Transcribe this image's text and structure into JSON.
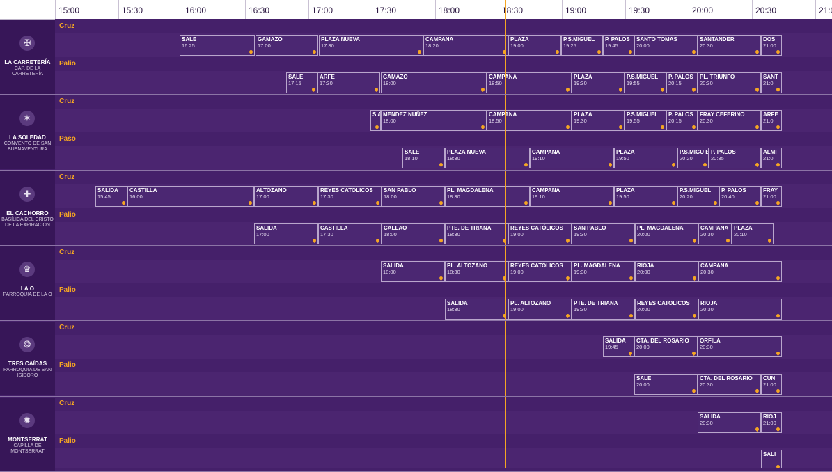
{
  "timeline": {
    "hours": [
      "15:00",
      "15:30",
      "16:00",
      "16:30",
      "17:00",
      "17:30",
      "18:00",
      "18:30",
      "19:00",
      "19:30",
      "20:00",
      "20:30",
      "21:0"
    ],
    "now_marker": "18:30"
  },
  "colors": {
    "accent": "#f5a623",
    "background": "#45206a",
    "sidebar": "#371658"
  },
  "brotherhoods": [
    {
      "name": "LA CARRETERÍA",
      "church": "CAP. DE LA CARRETERÍA",
      "emblem": "shield-icon",
      "lanes": [
        {
          "label": "Cruz",
          "stops": [
            {
              "n": "SALE",
              "t": "16:25"
            },
            {
              "n": "GAMAZO",
              "t": "17:00"
            },
            {
              "n": "PLAZA NUEVA",
              "t": "17:30"
            },
            {
              "n": "CAMPANA",
              "t": "18:20"
            },
            {
              "n": "PLAZA",
              "t": "19:00"
            },
            {
              "n": "P.S.MIGUEL",
              "t": "19:25"
            },
            {
              "n": "P. PALOS",
              "t": "19:45"
            },
            {
              "n": "SANTO TOMAS",
              "t": "20:00"
            },
            {
              "n": "SANTANDER",
              "t": "20:30"
            },
            {
              "n": "DOS",
              "t": "21:00"
            }
          ]
        },
        {
          "label": "Palio",
          "stops": [
            {
              "n": "SALE",
              "t": "17:15"
            },
            {
              "n": "ARFE",
              "t": "17:30"
            },
            {
              "n": "GAMAZO",
              "t": "18:00"
            },
            {
              "n": "CAMPANA",
              "t": "18:50"
            },
            {
              "n": "PLAZA",
              "t": "19:30"
            },
            {
              "n": "P.S.MIGUEL",
              "t": "19:55"
            },
            {
              "n": "P. PALOS",
              "t": "20:15"
            },
            {
              "n": "PL. TRIUNFO",
              "t": "20:30"
            },
            {
              "n": "SANT",
              "t": "21:0"
            }
          ]
        }
      ]
    },
    {
      "name": "LA SOLEDAD",
      "church": "CONVENTO DE SAN BUENAVENTURA",
      "emblem": "star-icon",
      "lanes": [
        {
          "label": "Cruz",
          "stops": [
            {
              "n": "S A L",
              "t": ""
            },
            {
              "n": "MENDEZ NUÑEZ",
              "t": "18:00"
            },
            {
              "n": "CAMPANA",
              "t": "18:50"
            },
            {
              "n": "PLAZA",
              "t": "19:30"
            },
            {
              "n": "P.S.MIGUEL",
              "t": "19:55"
            },
            {
              "n": "P. PALOS",
              "t": "20:15"
            },
            {
              "n": "FRAY CEFERINO",
              "t": "20:30"
            },
            {
              "n": "ARFE",
              "t": "21:0"
            }
          ]
        },
        {
          "label": "Paso",
          "stops": [
            {
              "n": "SALE",
              "t": "18:10"
            },
            {
              "n": "PLAZA NUEVA",
              "t": "18:30"
            },
            {
              "n": "CAMPANA",
              "t": "19:10"
            },
            {
              "n": "PLAZA",
              "t": "19:50"
            },
            {
              "n": "P.S.MIGU EL",
              "t": "20:20"
            },
            {
              "n": "P. PALOS",
              "t": "20:35"
            },
            {
              "n": "ALMI",
              "t": "21:0"
            }
          ]
        }
      ]
    },
    {
      "name": "EL CACHORRO",
      "church": "BASÍLICA DEL CRISTO DE LA EXPIRACIÓN",
      "emblem": "cross-icon",
      "lanes": [
        {
          "label": "Cruz",
          "stops": [
            {
              "n": "SALIDA",
              "t": "15:45"
            },
            {
              "n": "CASTILLA",
              "t": "16:00"
            },
            {
              "n": "ALTOZANO",
              "t": "17:00"
            },
            {
              "n": "REYES CATOLICOS",
              "t": "17:30"
            },
            {
              "n": "SAN PABLO",
              "t": "18:00"
            },
            {
              "n": "PL. MAGDALENA",
              "t": "18:30"
            },
            {
              "n": "CAMPANA",
              "t": "19:10"
            },
            {
              "n": "PLAZA",
              "t": "19:50"
            },
            {
              "n": "P.S.MIGUEL",
              "t": "20:20"
            },
            {
              "n": "P. PALOS",
              "t": "20:40"
            },
            {
              "n": "FRAY",
              "t": "21:00"
            }
          ]
        },
        {
          "label": "Palio",
          "stops": [
            {
              "n": "SALIDA",
              "t": "17:00"
            },
            {
              "n": "CASTILLA",
              "t": "17:30"
            },
            {
              "n": "CALLAO",
              "t": "18:00"
            },
            {
              "n": "PTE. DE TRIANA",
              "t": "18:30"
            },
            {
              "n": "REYES CATÓLICOS",
              "t": "19:00"
            },
            {
              "n": "SAN PABLO",
              "t": "19:30"
            },
            {
              "n": "PL. MAGDALENA",
              "t": "20:00"
            },
            {
              "n": "CAMPANA",
              "t": "20:30"
            },
            {
              "n": "PLAZA",
              "t": "20:10"
            }
          ]
        }
      ]
    },
    {
      "name": "LA O",
      "church": "PARROQUIA DE LA O",
      "emblem": "crown-icon",
      "lanes": [
        {
          "label": "Cruz",
          "stops": [
            {
              "n": "SALIDA",
              "t": "18:00"
            },
            {
              "n": "PL. ALTOZANO",
              "t": "18:30"
            },
            {
              "n": "REYES CATOLICOS",
              "t": "19:00"
            },
            {
              "n": "PL. MAGDALENA",
              "t": "19:30"
            },
            {
              "n": "RIOJA",
              "t": "20:00"
            },
            {
              "n": "CAMPANA",
              "t": "20:30"
            }
          ]
        },
        {
          "label": "Palio",
          "stops": [
            {
              "n": "SALIDA",
              "t": "18:30"
            },
            {
              "n": "PL. ALTOZANO",
              "t": "19:00"
            },
            {
              "n": "PTE. DE TRIANA",
              "t": "19:30"
            },
            {
              "n": "REYES CATOLICOS",
              "t": "20:00"
            },
            {
              "n": "RIOJA",
              "t": "20:30"
            }
          ]
        }
      ]
    },
    {
      "name": "TRES CAÍDAS",
      "church": "PARROQUIA DE SAN ISIDORO",
      "emblem": "seal-icon",
      "lanes": [
        {
          "label": "Cruz",
          "stops": [
            {
              "n": "SALIDA",
              "t": "19:45"
            },
            {
              "n": "CTA. DEL ROSARIO",
              "t": "20:00"
            },
            {
              "n": "ORFILA",
              "t": "20:30"
            }
          ]
        },
        {
          "label": "Palio",
          "stops": [
            {
              "n": "SALE",
              "t": "20:00"
            },
            {
              "n": "CTA. DEL ROSARIO",
              "t": "20:30"
            },
            {
              "n": "CUN",
              "t": "21:00"
            }
          ]
        }
      ]
    },
    {
      "name": "MONTSERRAT",
      "church": "CAPILLA DE MONTSERRAT",
      "emblem": "emblem-icon",
      "lanes": [
        {
          "label": "Cruz",
          "stops": [
            {
              "n": "SALIDA",
              "t": "20:30"
            },
            {
              "n": "RIOJ",
              "t": "21:00"
            }
          ]
        },
        {
          "label": "Palio",
          "stops": [
            {
              "n": "SALI",
              "t": ""
            }
          ]
        }
      ]
    }
  ]
}
